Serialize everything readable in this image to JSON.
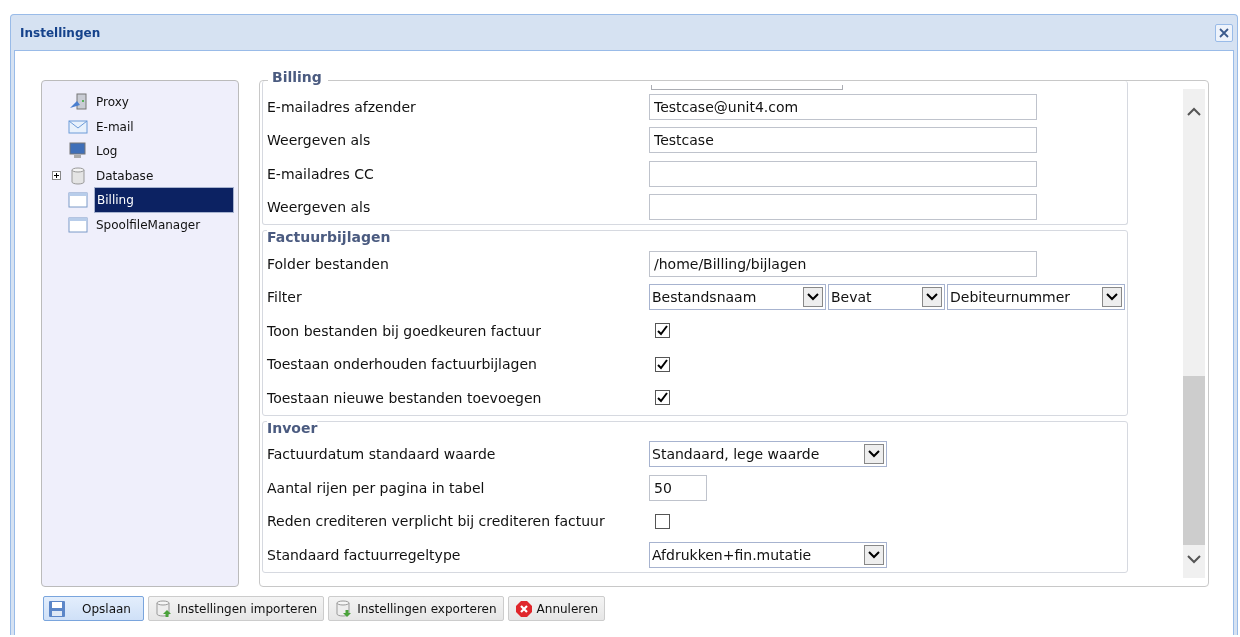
{
  "window": {
    "title": "Instellingen"
  },
  "tree": [
    {
      "label": "Proxy",
      "kind": "proxy",
      "selected": false
    },
    {
      "label": "E-mail",
      "kind": "email",
      "selected": false
    },
    {
      "label": "Log",
      "kind": "monitor",
      "selected": false
    },
    {
      "label": "Database",
      "kind": "database",
      "selected": false,
      "expanded": false
    },
    {
      "label": "Billing",
      "kind": "window",
      "selected": true
    },
    {
      "label": "SpoolfileManager",
      "kind": "window",
      "selected": false
    }
  ],
  "sections": [
    {
      "legend": "Billing",
      "rows": [
        {
          "kind": "text",
          "label": "E-mailadres afzender",
          "value": "Testcase@unit4.com"
        },
        {
          "kind": "text",
          "label": "Weergeven als",
          "value": "Testcase"
        },
        {
          "kind": "text",
          "label": "E-mailadres CC",
          "value": ""
        },
        {
          "kind": "text",
          "label": "Weergeven als",
          "value": ""
        }
      ]
    },
    {
      "legend": "Factuurbijlagen",
      "rows": [
        {
          "kind": "text",
          "label": "Folder bestanden",
          "value": "/home/Billing/bijlagen"
        },
        {
          "kind": "filter",
          "label": "Filter",
          "values": [
            "Bestandsnaam",
            "Bevat",
            "Debiteurnummer"
          ]
        },
        {
          "kind": "checkbox",
          "label": "Toon bestanden bij goedkeuren factuur",
          "checked": true
        },
        {
          "kind": "checkbox",
          "label": "Toestaan onderhouden factuurbijlagen",
          "checked": true
        },
        {
          "kind": "checkbox",
          "label": "Toestaan nieuwe bestanden toevoegen",
          "checked": true
        }
      ]
    },
    {
      "legend": "Invoer",
      "rows": [
        {
          "kind": "select",
          "label": "Factuurdatum standaard waarde",
          "value": "Standaard, lege waarde"
        },
        {
          "kind": "number",
          "label": "Aantal rijen per pagina in tabel",
          "value": "50"
        },
        {
          "kind": "checkbox",
          "label": "Reden crediteren verplicht bij crediteren factuur",
          "checked": false
        },
        {
          "kind": "select",
          "label": "Standaard factuurregeltype",
          "value": "Afdrukken+fin.mutatie"
        }
      ]
    }
  ],
  "buttons": [
    {
      "label": "Opslaan",
      "kind": "save",
      "focused": true
    },
    {
      "label": "Instellingen importeren",
      "kind": "import",
      "focused": false
    },
    {
      "label": "Instellingen exporteren",
      "kind": "export",
      "focused": false
    },
    {
      "label": "Annuleren",
      "kind": "cancel",
      "focused": false
    }
  ]
}
